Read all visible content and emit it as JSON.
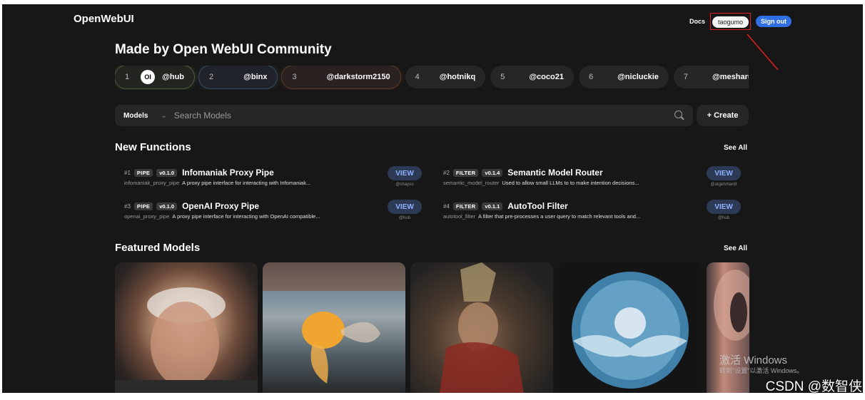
{
  "header": {
    "logo": "OpenWebUI",
    "docs_label": "Docs",
    "username": "taogumo",
    "signout_label": "Sign out"
  },
  "community": {
    "title": "Made by Open WebUI Community",
    "creators": [
      {
        "rank": "1",
        "handle": "@hub"
      },
      {
        "rank": "2",
        "handle": "@binx"
      },
      {
        "rank": "3",
        "handle": "@darkstorm2150"
      },
      {
        "rank": "4",
        "handle": "@hotnikq"
      },
      {
        "rank": "5",
        "handle": "@coco21"
      },
      {
        "rank": "6",
        "handle": "@nicluckie"
      },
      {
        "rank": "7",
        "handle": "@mesharu"
      }
    ],
    "hub_logo_text": "OI"
  },
  "search": {
    "filter_label": "Models",
    "placeholder": "Search Models",
    "create_label": "+ Create"
  },
  "functions": {
    "title": "New Functions",
    "see_all": "See All",
    "items": [
      {
        "num": "#1",
        "type": "PIPE",
        "version": "v0.1.0",
        "name": "Infomaniak Proxy Pipe",
        "id": "infomaniak_proxy_pipe",
        "description": "A proxy pipe interface for interacting with Infomaniak...",
        "view": "VIEW",
        "author": "@shayoo"
      },
      {
        "num": "#2",
        "type": "FILTER",
        "version": "v0.1.4",
        "name": "Semantic Model Router",
        "id": "semantic_model_router",
        "description": "Used to allow small LLMs to to make intention decisions...",
        "view": "VIEW",
        "author": "@atgehrhardt"
      },
      {
        "num": "#3",
        "type": "PIPE",
        "version": "v0.1.0",
        "name": "OpenAI Proxy Pipe",
        "id": "openai_proxy_pipe",
        "description": "A proxy pipe interface for interacting with OpenAI compatible...",
        "view": "VIEW",
        "author": "@hub"
      },
      {
        "num": "#4",
        "type": "FILTER",
        "version": "v0.1.1",
        "name": "AutoTool Filter",
        "id": "autotool_filter",
        "description": "A filter that pre-processes a user query to match relevant tools and...",
        "view": "VIEW",
        "author": "@hub"
      }
    ]
  },
  "featured": {
    "title": "Featured Models",
    "see_all": "See All"
  },
  "watermark": {
    "windows": "激活 Windows",
    "windows_sub": "转到\"设置\"以激活 Windows。",
    "csdn": "CSDN @数智侠"
  },
  "colors": {
    "background": "#171717",
    "accent": "#2f6fe6",
    "annotation": "#e0201c"
  }
}
